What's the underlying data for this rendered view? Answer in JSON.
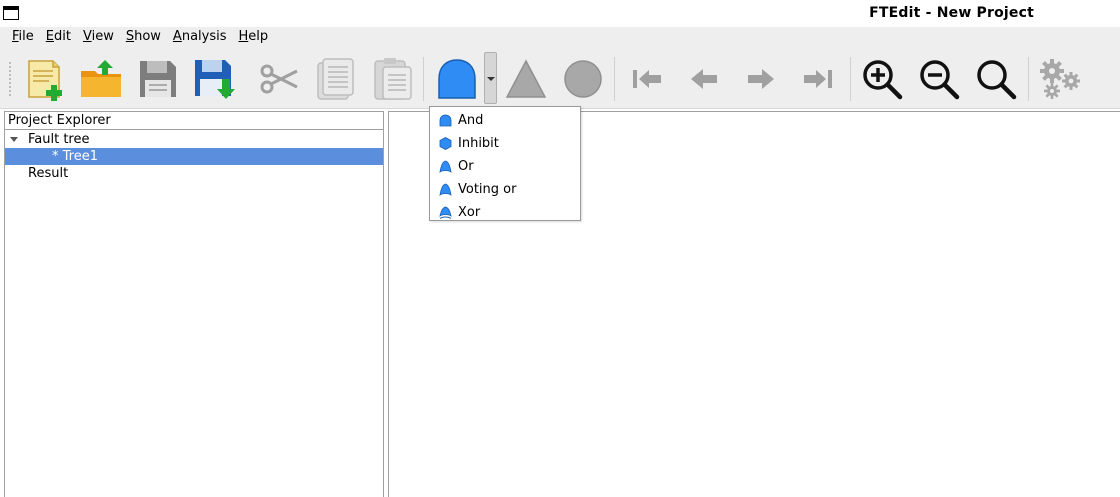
{
  "window": {
    "title": "FTEdit - New Project"
  },
  "menubar": {
    "items": [
      {
        "mnemonic": "F",
        "rest": "ile"
      },
      {
        "mnemonic": "E",
        "rest": "dit"
      },
      {
        "mnemonic": "V",
        "rest": "iew"
      },
      {
        "mnemonic": "S",
        "rest": "how"
      },
      {
        "mnemonic": "A",
        "rest": "nalysis"
      },
      {
        "mnemonic": "H",
        "rest": "elp"
      }
    ]
  },
  "toolbar": {
    "icons": [
      "new-project-icon",
      "open-folder-icon",
      "save-icon",
      "save-as-icon",
      "cut-icon",
      "copy-icon",
      "paste-icon",
      "and-gate-icon",
      "gate-dropdown-arrow",
      "triangle-icon",
      "circle-icon",
      "go-first-icon",
      "go-back-icon",
      "go-forward-icon",
      "go-last-icon",
      "zoom-in-icon",
      "zoom-out-icon",
      "zoom-reset-icon",
      "settings-icon"
    ]
  },
  "explorer": {
    "header": "Project Explorer",
    "tree": {
      "fault_tree": "Fault tree",
      "tree1": "* Tree1",
      "result": "Result"
    }
  },
  "gate_menu": {
    "items": [
      {
        "label": "And",
        "icon": "and-gate-icon"
      },
      {
        "label": "Inhibit",
        "icon": "inhibit-gate-icon"
      },
      {
        "label": "Or",
        "icon": "or-gate-icon"
      },
      {
        "label": "Voting or",
        "icon": "voting-or-gate-icon"
      },
      {
        "label": "Xor",
        "icon": "xor-gate-icon"
      }
    ]
  },
  "colors": {
    "gate_blue": "#2f8cf5",
    "selection": "#5b8fdd",
    "disabled_gray": "#a8a8a8",
    "green_accent": "#22aa33",
    "folder_orange": "#f5a623",
    "save_blue": "#1f5fb5"
  }
}
